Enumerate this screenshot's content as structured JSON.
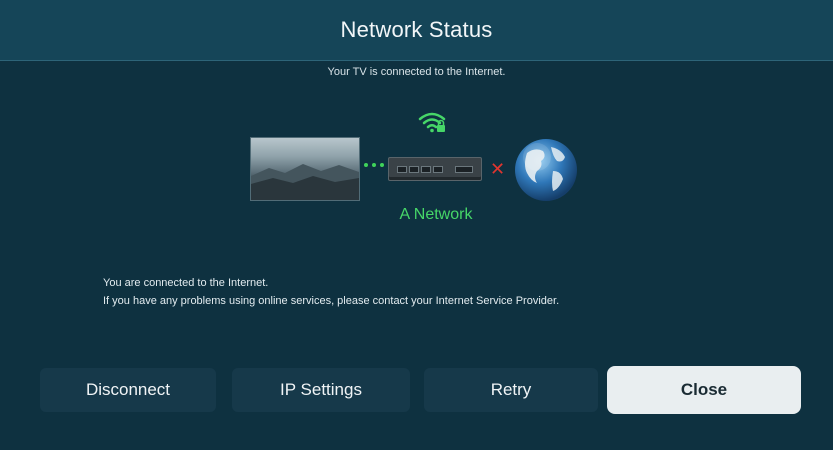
{
  "header": {
    "title": "Network Status"
  },
  "status_line": "Your TV is connected to the Internet.",
  "diagram": {
    "network_name": "A Network",
    "wifi_icon": "wifi-lock-icon",
    "internet_link_mark": "✕",
    "colors": {
      "connected": "#46d668",
      "disconnected": "#e0352f"
    }
  },
  "message": {
    "line1": "You are connected to the Internet.",
    "line2": "If you have any problems using online services, please contact your Internet Service Provider."
  },
  "buttons": {
    "disconnect": "Disconnect",
    "ip_settings": "IP Settings",
    "retry": "Retry",
    "close": "Close"
  }
}
